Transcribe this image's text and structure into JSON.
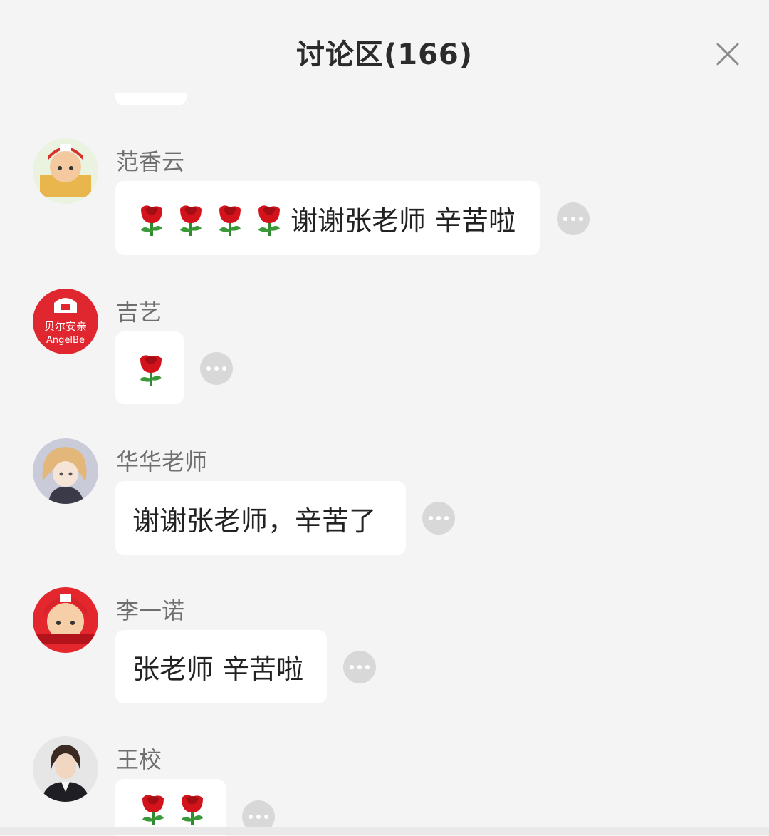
{
  "header": {
    "title": "讨论区(166)",
    "close_icon": "close-icon"
  },
  "comments": [
    {
      "username": "范香云",
      "avatar_icon": "cartoon-boy-avatar",
      "roses": 4,
      "text": "谢谢张老师 辛苦啦"
    },
    {
      "username": "吉艺",
      "avatar_icon": "angel-baby-logo-avatar",
      "avatar_text": [
        "贝尔安亲",
        "AngelBe"
      ],
      "roses": 1,
      "text": ""
    },
    {
      "username": "华华老师",
      "avatar_icon": "anime-girl-avatar",
      "roses": 0,
      "text": "谢谢张老师，辛苦了"
    },
    {
      "username": "李一诺",
      "avatar_icon": "cartoon-kid-red-cap-avatar",
      "roses": 0,
      "text": "张老师 辛苦啦"
    },
    {
      "username": "王校",
      "avatar_icon": "portrait-photo-avatar",
      "roses": 2,
      "text": ""
    }
  ],
  "colors": {
    "background": "#f4f4f4",
    "bubble": "#ffffff",
    "rose": "#d3121c",
    "more_button": "#d8d8d8"
  }
}
